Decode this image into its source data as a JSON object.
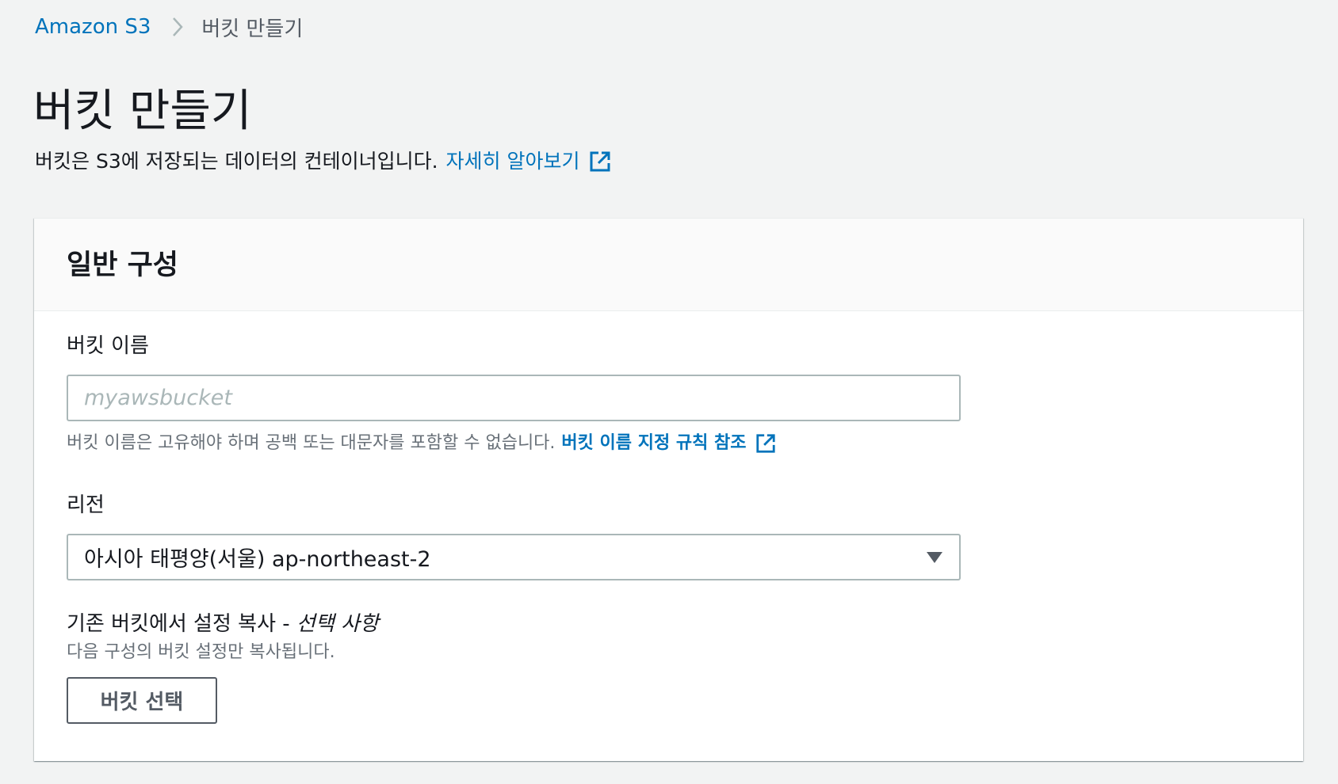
{
  "breadcrumb": {
    "root": "Amazon S3",
    "current": "버킷 만들기"
  },
  "page": {
    "title": "버킷 만들기",
    "description": "버킷은 S3에 저장되는 데이터의 컨테이너입니다.",
    "learn_more": "자세히 알아보기"
  },
  "general_config": {
    "title": "일반 구성",
    "bucket_name": {
      "label": "버킷 이름",
      "value": "",
      "placeholder": "myawsbucket",
      "hint": "버킷 이름은 고유해야 하며 공백 또는 대문자를 포함할 수 없습니다.",
      "rules_link": "버킷 이름 지정 규칙 참조"
    },
    "region": {
      "label": "리전",
      "selected": "아시아 태평양(서울) ap-northeast-2"
    },
    "copy_settings": {
      "label": "기존 버킷에서 설정 복사 - ",
      "optional": "선택 사항",
      "description": "다음 구성의 버킷 설정만 복사됩니다.",
      "button": "버킷 선택"
    }
  },
  "icons": {
    "breadcrumb_separator": "chevron-right-icon",
    "external_link": "external-link-icon",
    "dropdown": "caret-down-icon"
  },
  "colors": {
    "link": "#0073bb",
    "background": "#f2f3f3",
    "text": "#16191f",
    "secondary_text": "#687078",
    "border": "#aab7b8"
  }
}
